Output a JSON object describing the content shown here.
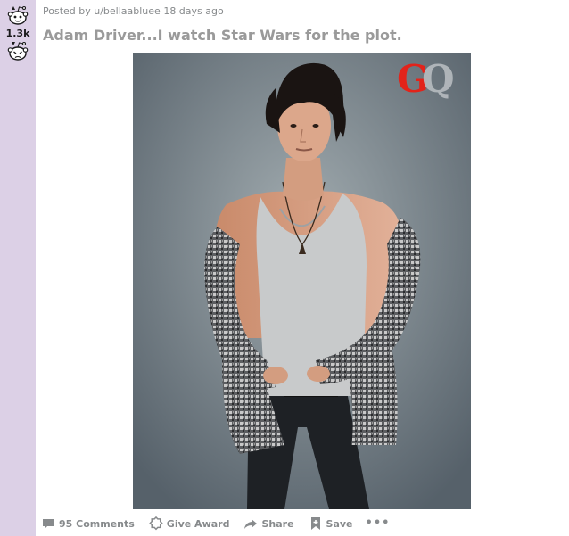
{
  "post": {
    "score": "1.3k",
    "meta": "Posted by u/bellaabluee 18 days ago",
    "title": "Adam Driver...I watch Star Wars for the plot.",
    "image": {
      "logo_text": "GQ",
      "colors": {
        "logo_g": "#e2231a",
        "logo_q": "#b7bcc0",
        "backdrop": "#7d878c"
      }
    }
  },
  "actions": {
    "comments": "95 Comments",
    "award": "Give Award",
    "share": "Share",
    "save": "Save",
    "more": "•••"
  },
  "icons": {
    "upvote": "snoo-upvote-icon",
    "downvote": "snoo-downvote-icon",
    "comments": "comment-bubble-icon",
    "award": "award-badge-icon",
    "share": "share-arrow-icon",
    "save": "bookmark-plus-icon"
  },
  "colors": {
    "vote_sidebar": "#dcd0e6",
    "muted_text": "#878a8c",
    "title_text": "#9a9a9a"
  }
}
